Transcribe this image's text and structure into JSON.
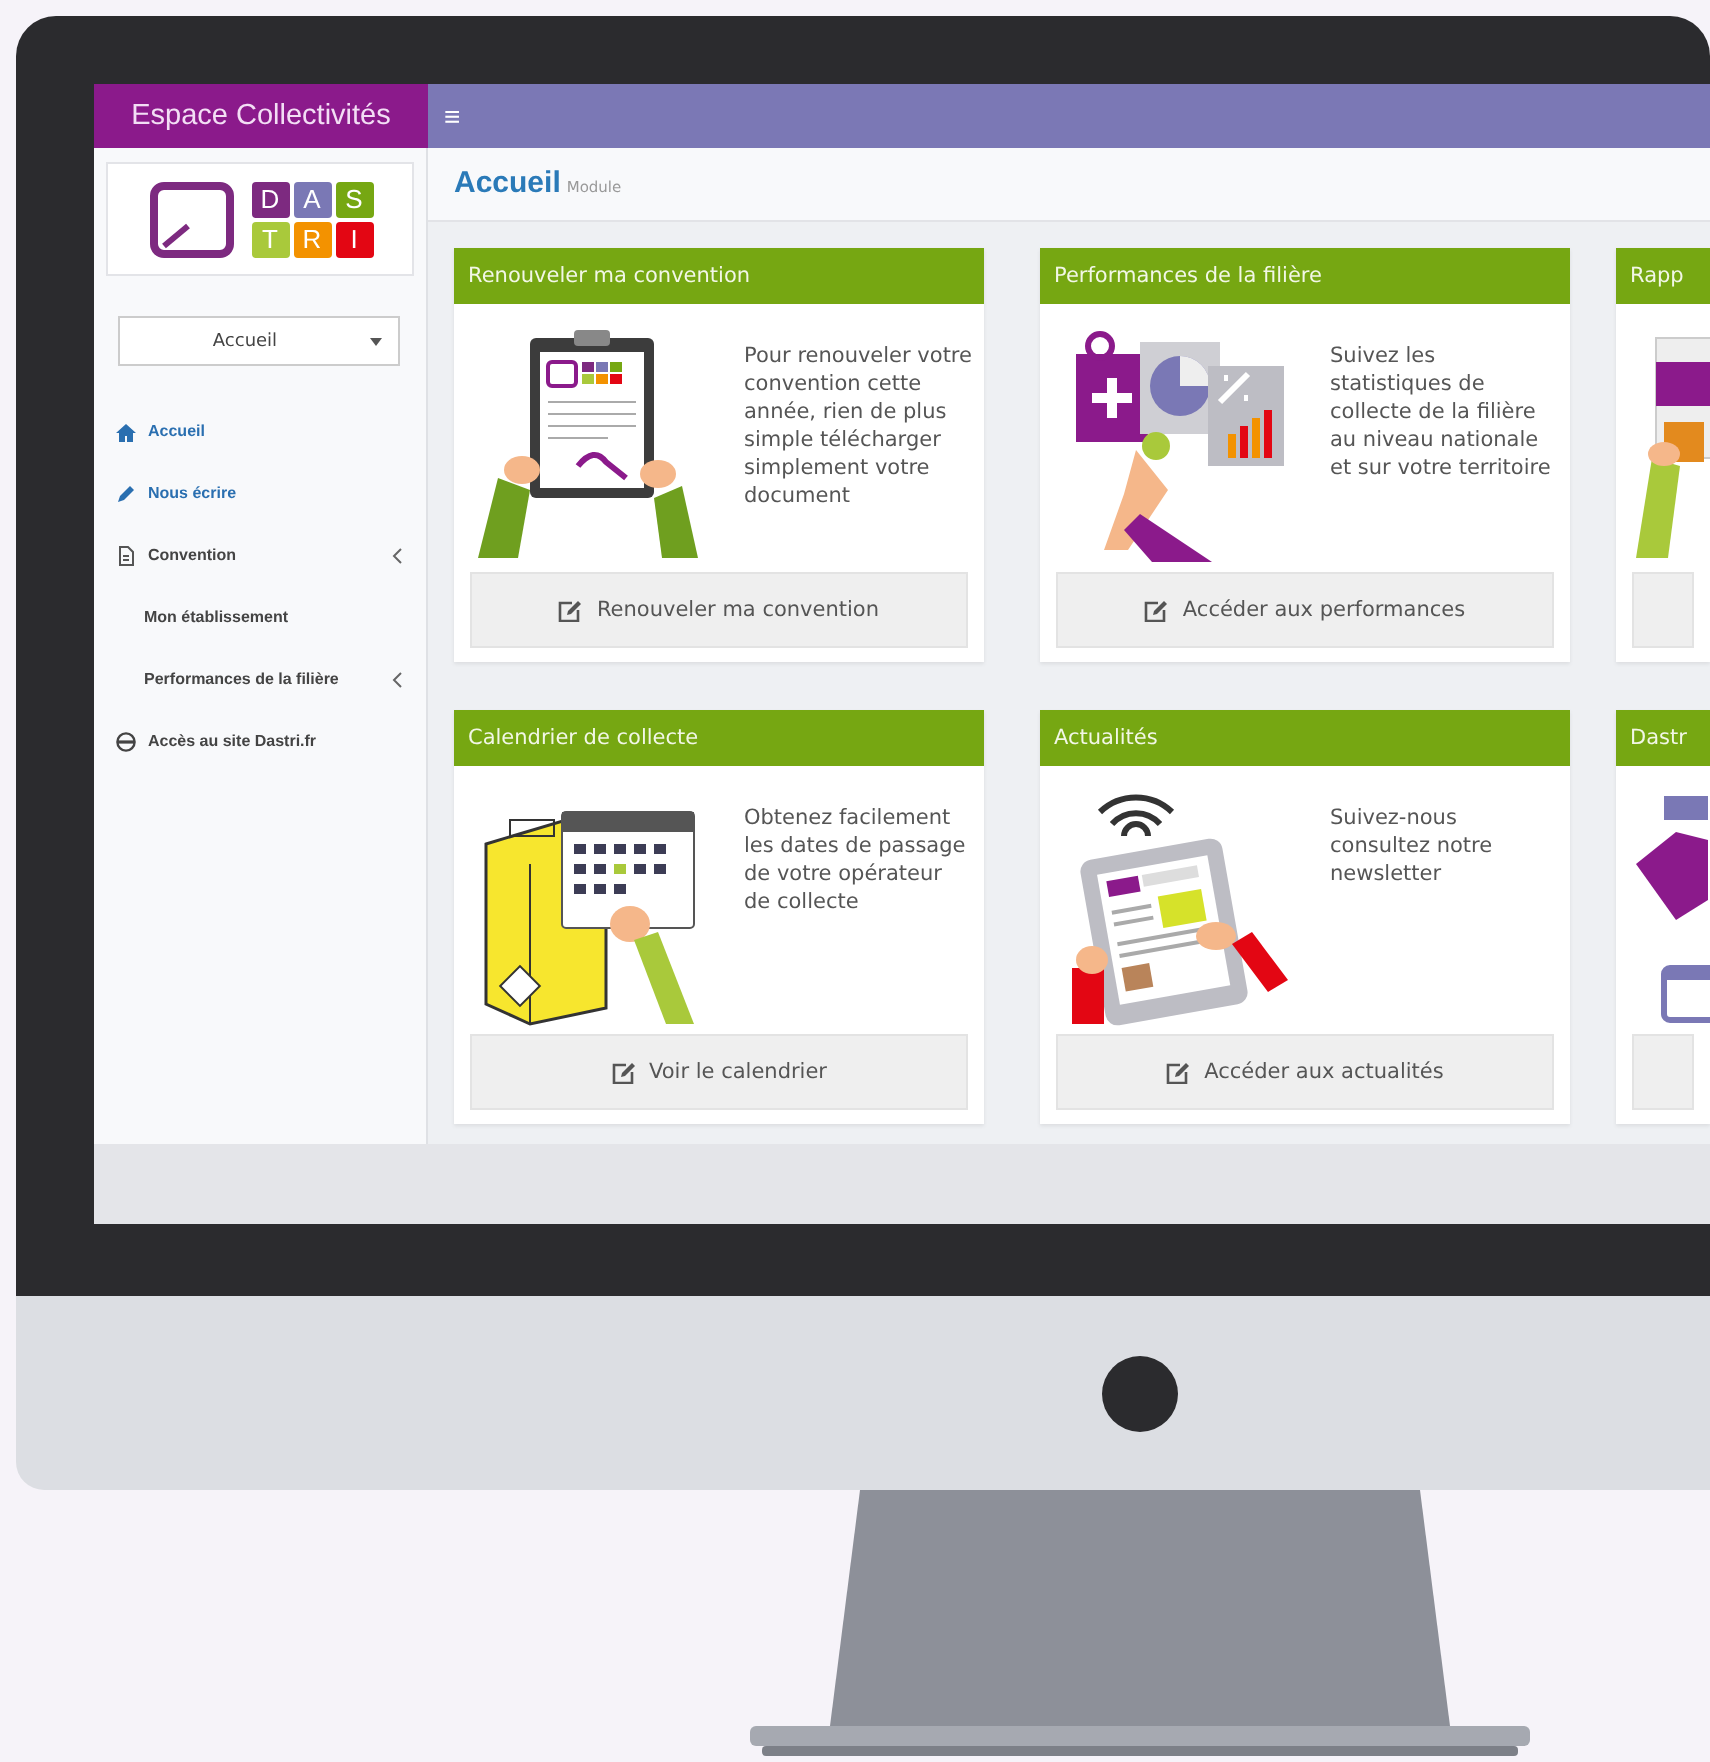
{
  "brand": {
    "title": "Espace Collectivités"
  },
  "topbar": {
    "menu_glyph": "≡"
  },
  "logo": {
    "letters": [
      {
        "text": "D",
        "color": "#7d2a80"
      },
      {
        "text": "A",
        "color": "#7a78b5"
      },
      {
        "text": "S",
        "color": "#76a712"
      },
      {
        "text": "T",
        "color": "#a9c93b"
      },
      {
        "text": "R",
        "color": "#f39200"
      },
      {
        "text": "I",
        "color": "#e30613"
      }
    ]
  },
  "dropdown": {
    "value": "Accueil"
  },
  "sidebar": {
    "items": [
      {
        "label": "Accueil",
        "kind": "home",
        "has_submenu": false
      },
      {
        "label": "Nous écrire",
        "kind": "compose",
        "has_submenu": false
      },
      {
        "label": "Convention",
        "kind": "section",
        "has_submenu": true,
        "children": [
          {
            "label": "Mon établissement",
            "has_submenu": false
          },
          {
            "label": "Performances de la filière",
            "has_submenu": true
          }
        ]
      },
      {
        "label": "Accès au site Dastri.fr",
        "kind": "external",
        "has_submenu": false
      }
    ]
  },
  "page_header": {
    "title": "Accueil",
    "subtitle": "Module"
  },
  "cards": [
    {
      "title": "Renouveler ma convention",
      "kind": "clipboard",
      "text": "Pour renouveler votre convention cette année, rien de plus simple télécharger simplement votre document",
      "button": "Renouveler ma convention"
    },
    {
      "title": "Performances de la filière",
      "kind": "charts",
      "text": "Suivez les statistiques de collecte de la filière au niveau nationale et sur votre territoire",
      "button": "Accéder aux performances"
    },
    {
      "title": "Rapp",
      "kind": "report"
    },
    {
      "title": "Calendrier de collecte",
      "kind": "calendar-box",
      "text": "Obtenez facilement les dates de passage de votre opérateur de collecte",
      "button": "Voir le calendrier"
    },
    {
      "title": "Actualités",
      "kind": "news",
      "text": "Suivez-nous consultez notre newsletter",
      "button": "Accéder aux actualités"
    },
    {
      "title": "Dastr",
      "kind": "calendar"
    }
  ]
}
